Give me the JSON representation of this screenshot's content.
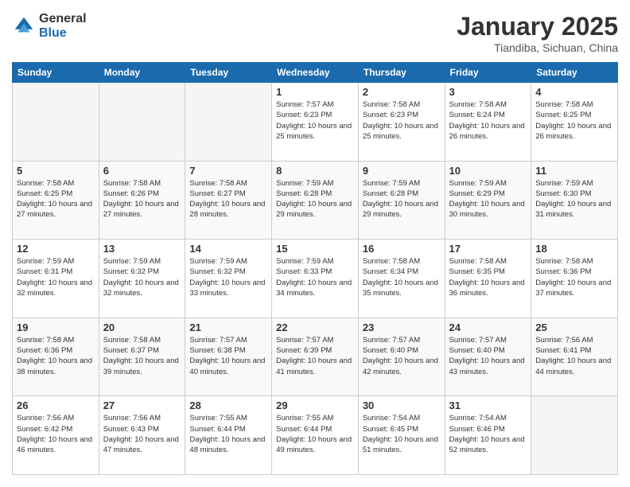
{
  "logo": {
    "general": "General",
    "blue": "Blue"
  },
  "header": {
    "month_year": "January 2025",
    "location": "Tiandiba, Sichuan, China"
  },
  "weekdays": [
    "Sunday",
    "Monday",
    "Tuesday",
    "Wednesday",
    "Thursday",
    "Friday",
    "Saturday"
  ],
  "weeks": [
    [
      {
        "day": "",
        "sunrise": "",
        "sunset": "",
        "daylight": "",
        "empty": true
      },
      {
        "day": "",
        "sunrise": "",
        "sunset": "",
        "daylight": "",
        "empty": true
      },
      {
        "day": "",
        "sunrise": "",
        "sunset": "",
        "daylight": "",
        "empty": true
      },
      {
        "day": "1",
        "sunrise": "Sunrise: 7:57 AM",
        "sunset": "Sunset: 6:23 PM",
        "daylight": "Daylight: 10 hours and 25 minutes."
      },
      {
        "day": "2",
        "sunrise": "Sunrise: 7:58 AM",
        "sunset": "Sunset: 6:23 PM",
        "daylight": "Daylight: 10 hours and 25 minutes."
      },
      {
        "day": "3",
        "sunrise": "Sunrise: 7:58 AM",
        "sunset": "Sunset: 6:24 PM",
        "daylight": "Daylight: 10 hours and 26 minutes."
      },
      {
        "day": "4",
        "sunrise": "Sunrise: 7:58 AM",
        "sunset": "Sunset: 6:25 PM",
        "daylight": "Daylight: 10 hours and 26 minutes."
      }
    ],
    [
      {
        "day": "5",
        "sunrise": "Sunrise: 7:58 AM",
        "sunset": "Sunset: 6:25 PM",
        "daylight": "Daylight: 10 hours and 27 minutes."
      },
      {
        "day": "6",
        "sunrise": "Sunrise: 7:58 AM",
        "sunset": "Sunset: 6:26 PM",
        "daylight": "Daylight: 10 hours and 27 minutes."
      },
      {
        "day": "7",
        "sunrise": "Sunrise: 7:58 AM",
        "sunset": "Sunset: 6:27 PM",
        "daylight": "Daylight: 10 hours and 28 minutes."
      },
      {
        "day": "8",
        "sunrise": "Sunrise: 7:59 AM",
        "sunset": "Sunset: 6:28 PM",
        "daylight": "Daylight: 10 hours and 29 minutes."
      },
      {
        "day": "9",
        "sunrise": "Sunrise: 7:59 AM",
        "sunset": "Sunset: 6:28 PM",
        "daylight": "Daylight: 10 hours and 29 minutes."
      },
      {
        "day": "10",
        "sunrise": "Sunrise: 7:59 AM",
        "sunset": "Sunset: 6:29 PM",
        "daylight": "Daylight: 10 hours and 30 minutes."
      },
      {
        "day": "11",
        "sunrise": "Sunrise: 7:59 AM",
        "sunset": "Sunset: 6:30 PM",
        "daylight": "Daylight: 10 hours and 31 minutes."
      }
    ],
    [
      {
        "day": "12",
        "sunrise": "Sunrise: 7:59 AM",
        "sunset": "Sunset: 6:31 PM",
        "daylight": "Daylight: 10 hours and 32 minutes."
      },
      {
        "day": "13",
        "sunrise": "Sunrise: 7:59 AM",
        "sunset": "Sunset: 6:32 PM",
        "daylight": "Daylight: 10 hours and 32 minutes."
      },
      {
        "day": "14",
        "sunrise": "Sunrise: 7:59 AM",
        "sunset": "Sunset: 6:32 PM",
        "daylight": "Daylight: 10 hours and 33 minutes."
      },
      {
        "day": "15",
        "sunrise": "Sunrise: 7:59 AM",
        "sunset": "Sunset: 6:33 PM",
        "daylight": "Daylight: 10 hours and 34 minutes."
      },
      {
        "day": "16",
        "sunrise": "Sunrise: 7:58 AM",
        "sunset": "Sunset: 6:34 PM",
        "daylight": "Daylight: 10 hours and 35 minutes."
      },
      {
        "day": "17",
        "sunrise": "Sunrise: 7:58 AM",
        "sunset": "Sunset: 6:35 PM",
        "daylight": "Daylight: 10 hours and 36 minutes."
      },
      {
        "day": "18",
        "sunrise": "Sunrise: 7:58 AM",
        "sunset": "Sunset: 6:36 PM",
        "daylight": "Daylight: 10 hours and 37 minutes."
      }
    ],
    [
      {
        "day": "19",
        "sunrise": "Sunrise: 7:58 AM",
        "sunset": "Sunset: 6:36 PM",
        "daylight": "Daylight: 10 hours and 38 minutes."
      },
      {
        "day": "20",
        "sunrise": "Sunrise: 7:58 AM",
        "sunset": "Sunset: 6:37 PM",
        "daylight": "Daylight: 10 hours and 39 minutes."
      },
      {
        "day": "21",
        "sunrise": "Sunrise: 7:57 AM",
        "sunset": "Sunset: 6:38 PM",
        "daylight": "Daylight: 10 hours and 40 minutes."
      },
      {
        "day": "22",
        "sunrise": "Sunrise: 7:57 AM",
        "sunset": "Sunset: 6:39 PM",
        "daylight": "Daylight: 10 hours and 41 minutes."
      },
      {
        "day": "23",
        "sunrise": "Sunrise: 7:57 AM",
        "sunset": "Sunset: 6:40 PM",
        "daylight": "Daylight: 10 hours and 42 minutes."
      },
      {
        "day": "24",
        "sunrise": "Sunrise: 7:57 AM",
        "sunset": "Sunset: 6:40 PM",
        "daylight": "Daylight: 10 hours and 43 minutes."
      },
      {
        "day": "25",
        "sunrise": "Sunrise: 7:56 AM",
        "sunset": "Sunset: 6:41 PM",
        "daylight": "Daylight: 10 hours and 44 minutes."
      }
    ],
    [
      {
        "day": "26",
        "sunrise": "Sunrise: 7:56 AM",
        "sunset": "Sunset: 6:42 PM",
        "daylight": "Daylight: 10 hours and 46 minutes."
      },
      {
        "day": "27",
        "sunrise": "Sunrise: 7:56 AM",
        "sunset": "Sunset: 6:43 PM",
        "daylight": "Daylight: 10 hours and 47 minutes."
      },
      {
        "day": "28",
        "sunrise": "Sunrise: 7:55 AM",
        "sunset": "Sunset: 6:44 PM",
        "daylight": "Daylight: 10 hours and 48 minutes."
      },
      {
        "day": "29",
        "sunrise": "Sunrise: 7:55 AM",
        "sunset": "Sunset: 6:44 PM",
        "daylight": "Daylight: 10 hours and 49 minutes."
      },
      {
        "day": "30",
        "sunrise": "Sunrise: 7:54 AM",
        "sunset": "Sunset: 6:45 PM",
        "daylight": "Daylight: 10 hours and 51 minutes."
      },
      {
        "day": "31",
        "sunrise": "Sunrise: 7:54 AM",
        "sunset": "Sunset: 6:46 PM",
        "daylight": "Daylight: 10 hours and 52 minutes."
      },
      {
        "day": "",
        "sunrise": "",
        "sunset": "",
        "daylight": "",
        "empty": true
      }
    ]
  ]
}
